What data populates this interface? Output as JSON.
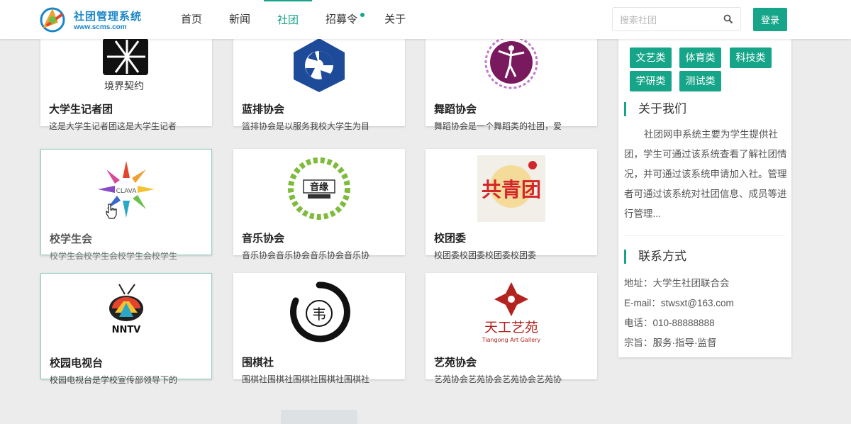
{
  "header": {
    "logo_title": "社团管理系统",
    "logo_url": "www.scms.com",
    "nav": [
      {
        "label": "首页"
      },
      {
        "label": "新闻"
      },
      {
        "label": "社团",
        "active": true
      },
      {
        "label": "招募令",
        "badge_dot": true
      },
      {
        "label": "关于"
      }
    ],
    "search_placeholder": "搜索社团",
    "login_label": "登录"
  },
  "clubs": [
    {
      "name": "大学生记者团",
      "desc": "这是大学生记者团这是大学生记者",
      "logo": "jingjie-qiyue-logo",
      "logo_text": "境界契约"
    },
    {
      "name": "蓝排协会",
      "desc": "篮排协会是以服务我校大学生为目",
      "logo": "volleyball-logo"
    },
    {
      "name": "舞蹈协会",
      "desc": "舞蹈协会是一个舞蹈类的社团，爱",
      "logo": "dancer-logo"
    },
    {
      "name": "校学生会",
      "desc": "校学生会校学生会校学生会校学生",
      "logo": "clava-sunburst-logo",
      "logo_text": "CLAVA"
    },
    {
      "name": "音乐协会",
      "desc": "音乐协会音乐协会音乐协会音乐协",
      "logo": "music-wreath-logo",
      "logo_text": "音缘"
    },
    {
      "name": "校团委",
      "desc": "校团委校团委校团委校团委",
      "logo": "gongqingtuan-logo",
      "logo_text": "共青团"
    },
    {
      "name": "校园电视台",
      "desc": "校园电视台是学校宣传部领导下的",
      "logo": "nntv-logo",
      "logo_text": "NNTV"
    },
    {
      "name": "围棋社",
      "desc": "围棋社围棋社围棋社围棋社围棋社",
      "logo": "weiqi-brush-logo",
      "logo_text": "韦"
    },
    {
      "name": "艺苑协会",
      "desc": "艺苑协会艺苑协会艺苑协会艺苑协",
      "logo": "tiangong-art-logo",
      "logo_text": "天工艺苑",
      "logo_subtext": "Tiangong Art Gallery"
    }
  ],
  "sidebar": {
    "tags": [
      "文艺类",
      "体育类",
      "科技类",
      "学研类",
      "测试类"
    ],
    "about_title": "关于我们",
    "about_text": "社团网申系统主要为学生提供社团，学生可通过该系统查看了解社团情况，并可通过该系统申请加入社。管理者可通过该系统对社团信息、成员等进行管理...",
    "contact_title": "联系方式",
    "contact": {
      "address": "地址：大学生社团联合会",
      "email": "E-mail：stwsxt@163.com",
      "phone": "电话：010-88888888",
      "motto": "宗旨：服务·指导·监督"
    }
  },
  "colors": {
    "accent": "#17a589",
    "brand": "#1a86c7"
  }
}
